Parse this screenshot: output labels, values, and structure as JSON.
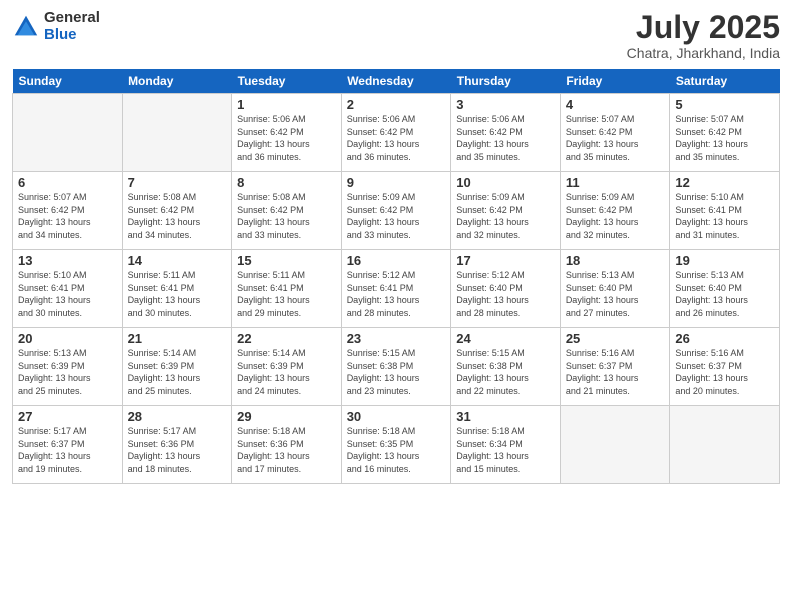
{
  "header": {
    "logo": {
      "general": "General",
      "blue": "Blue"
    },
    "title": "July 2025",
    "location": "Chatra, Jharkhand, India"
  },
  "weekdays": [
    "Sunday",
    "Monday",
    "Tuesday",
    "Wednesday",
    "Thursday",
    "Friday",
    "Saturday"
  ],
  "weeks": [
    [
      {
        "day": "",
        "info": ""
      },
      {
        "day": "",
        "info": ""
      },
      {
        "day": "1",
        "info": "Sunrise: 5:06 AM\nSunset: 6:42 PM\nDaylight: 13 hours\nand 36 minutes."
      },
      {
        "day": "2",
        "info": "Sunrise: 5:06 AM\nSunset: 6:42 PM\nDaylight: 13 hours\nand 36 minutes."
      },
      {
        "day": "3",
        "info": "Sunrise: 5:06 AM\nSunset: 6:42 PM\nDaylight: 13 hours\nand 35 minutes."
      },
      {
        "day": "4",
        "info": "Sunrise: 5:07 AM\nSunset: 6:42 PM\nDaylight: 13 hours\nand 35 minutes."
      },
      {
        "day": "5",
        "info": "Sunrise: 5:07 AM\nSunset: 6:42 PM\nDaylight: 13 hours\nand 35 minutes."
      }
    ],
    [
      {
        "day": "6",
        "info": "Sunrise: 5:07 AM\nSunset: 6:42 PM\nDaylight: 13 hours\nand 34 minutes."
      },
      {
        "day": "7",
        "info": "Sunrise: 5:08 AM\nSunset: 6:42 PM\nDaylight: 13 hours\nand 34 minutes."
      },
      {
        "day": "8",
        "info": "Sunrise: 5:08 AM\nSunset: 6:42 PM\nDaylight: 13 hours\nand 33 minutes."
      },
      {
        "day": "9",
        "info": "Sunrise: 5:09 AM\nSunset: 6:42 PM\nDaylight: 13 hours\nand 33 minutes."
      },
      {
        "day": "10",
        "info": "Sunrise: 5:09 AM\nSunset: 6:42 PM\nDaylight: 13 hours\nand 32 minutes."
      },
      {
        "day": "11",
        "info": "Sunrise: 5:09 AM\nSunset: 6:42 PM\nDaylight: 13 hours\nand 32 minutes."
      },
      {
        "day": "12",
        "info": "Sunrise: 5:10 AM\nSunset: 6:41 PM\nDaylight: 13 hours\nand 31 minutes."
      }
    ],
    [
      {
        "day": "13",
        "info": "Sunrise: 5:10 AM\nSunset: 6:41 PM\nDaylight: 13 hours\nand 30 minutes."
      },
      {
        "day": "14",
        "info": "Sunrise: 5:11 AM\nSunset: 6:41 PM\nDaylight: 13 hours\nand 30 minutes."
      },
      {
        "day": "15",
        "info": "Sunrise: 5:11 AM\nSunset: 6:41 PM\nDaylight: 13 hours\nand 29 minutes."
      },
      {
        "day": "16",
        "info": "Sunrise: 5:12 AM\nSunset: 6:41 PM\nDaylight: 13 hours\nand 28 minutes."
      },
      {
        "day": "17",
        "info": "Sunrise: 5:12 AM\nSunset: 6:40 PM\nDaylight: 13 hours\nand 28 minutes."
      },
      {
        "day": "18",
        "info": "Sunrise: 5:13 AM\nSunset: 6:40 PM\nDaylight: 13 hours\nand 27 minutes."
      },
      {
        "day": "19",
        "info": "Sunrise: 5:13 AM\nSunset: 6:40 PM\nDaylight: 13 hours\nand 26 minutes."
      }
    ],
    [
      {
        "day": "20",
        "info": "Sunrise: 5:13 AM\nSunset: 6:39 PM\nDaylight: 13 hours\nand 25 minutes."
      },
      {
        "day": "21",
        "info": "Sunrise: 5:14 AM\nSunset: 6:39 PM\nDaylight: 13 hours\nand 25 minutes."
      },
      {
        "day": "22",
        "info": "Sunrise: 5:14 AM\nSunset: 6:39 PM\nDaylight: 13 hours\nand 24 minutes."
      },
      {
        "day": "23",
        "info": "Sunrise: 5:15 AM\nSunset: 6:38 PM\nDaylight: 13 hours\nand 23 minutes."
      },
      {
        "day": "24",
        "info": "Sunrise: 5:15 AM\nSunset: 6:38 PM\nDaylight: 13 hours\nand 22 minutes."
      },
      {
        "day": "25",
        "info": "Sunrise: 5:16 AM\nSunset: 6:37 PM\nDaylight: 13 hours\nand 21 minutes."
      },
      {
        "day": "26",
        "info": "Sunrise: 5:16 AM\nSunset: 6:37 PM\nDaylight: 13 hours\nand 20 minutes."
      }
    ],
    [
      {
        "day": "27",
        "info": "Sunrise: 5:17 AM\nSunset: 6:37 PM\nDaylight: 13 hours\nand 19 minutes."
      },
      {
        "day": "28",
        "info": "Sunrise: 5:17 AM\nSunset: 6:36 PM\nDaylight: 13 hours\nand 18 minutes."
      },
      {
        "day": "29",
        "info": "Sunrise: 5:18 AM\nSunset: 6:36 PM\nDaylight: 13 hours\nand 17 minutes."
      },
      {
        "day": "30",
        "info": "Sunrise: 5:18 AM\nSunset: 6:35 PM\nDaylight: 13 hours\nand 16 minutes."
      },
      {
        "day": "31",
        "info": "Sunrise: 5:18 AM\nSunset: 6:34 PM\nDaylight: 13 hours\nand 15 minutes."
      },
      {
        "day": "",
        "info": ""
      },
      {
        "day": "",
        "info": ""
      }
    ]
  ]
}
